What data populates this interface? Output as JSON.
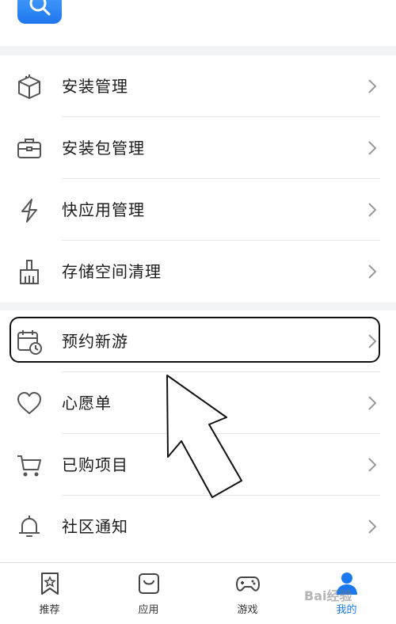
{
  "top": {
    "app_icon": "search-icon"
  },
  "menu_group_1": [
    {
      "label": "安装管理",
      "icon": "package-icon"
    },
    {
      "label": "安装包管理",
      "icon": "briefcase-icon"
    },
    {
      "label": "快应用管理",
      "icon": "lightning-icon"
    },
    {
      "label": "存储空间清理",
      "icon": "brush-icon"
    }
  ],
  "menu_group_2": [
    {
      "label": "预约新游",
      "icon": "calendar-clock-icon"
    },
    {
      "label": "心愿单",
      "icon": "heart-icon"
    },
    {
      "label": "已购项目",
      "icon": "cart-icon"
    },
    {
      "label": "社区通知",
      "icon": "bell-icon"
    }
  ],
  "tabs": [
    {
      "label": "推荐",
      "icon": "bookmark-star-icon"
    },
    {
      "label": "应用",
      "icon": "bag-icon"
    },
    {
      "label": "游戏",
      "icon": "gamepad-icon"
    },
    {
      "label": "我的",
      "icon": "person-icon",
      "active": true
    }
  ],
  "colors": {
    "accent": "#1a78f0",
    "icon_gray": "#555555",
    "separator": "#e6e6e6"
  },
  "watermark": "Bai经验"
}
